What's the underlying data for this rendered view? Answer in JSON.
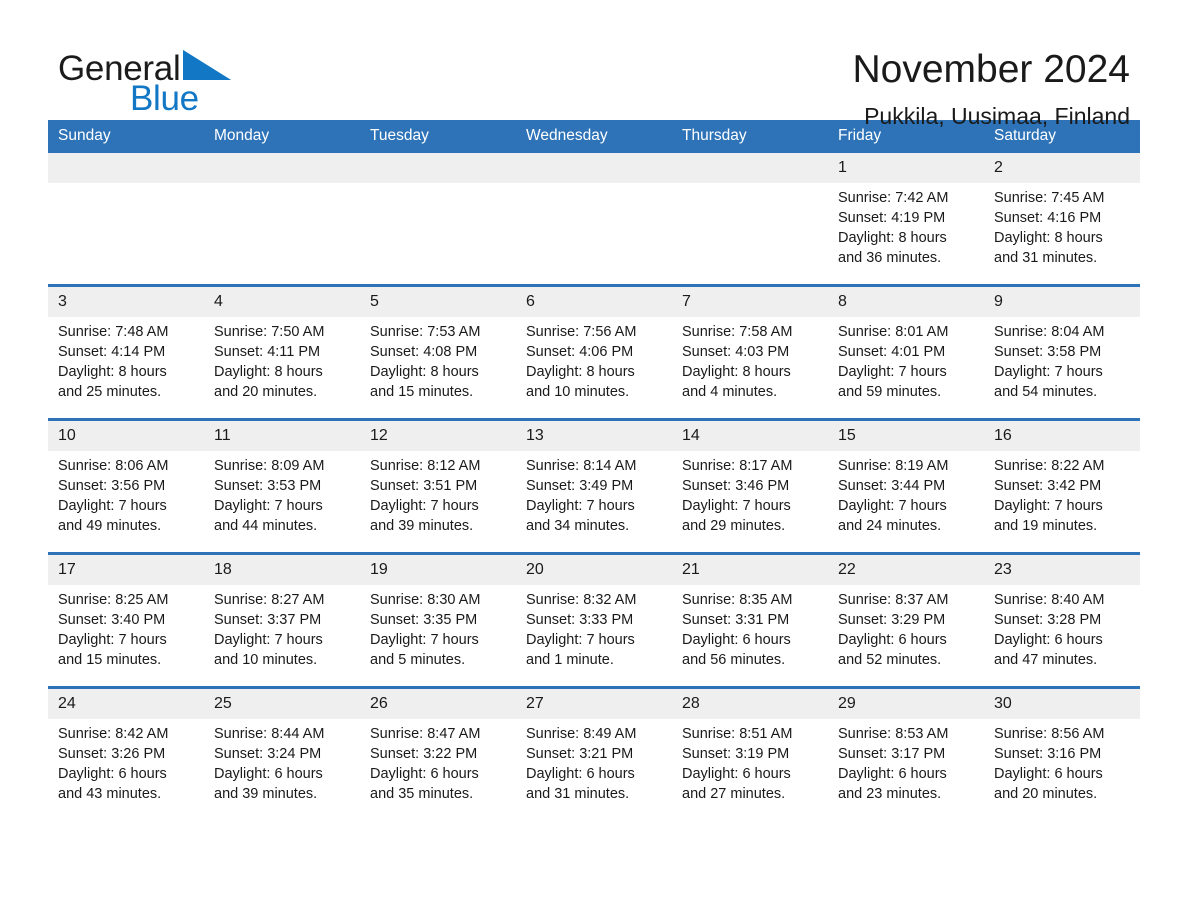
{
  "brand": {
    "word1": "General",
    "word2": "Blue",
    "logo_icon": "blue-triangle-icon",
    "accent_color": "#1277c4"
  },
  "header": {
    "title": "November 2024",
    "subtitle": "Pukkila, Uusimaa, Finland"
  },
  "calendar": {
    "header_bg": "#2e73b8",
    "daynum_bg": "#efefef",
    "weekday_headers": [
      "Sunday",
      "Monday",
      "Tuesday",
      "Wednesday",
      "Thursday",
      "Friday",
      "Saturday"
    ],
    "weeks": [
      [
        {
          "day": "",
          "sunrise": "",
          "sunset": "",
          "daylight1": "",
          "daylight2": ""
        },
        {
          "day": "",
          "sunrise": "",
          "sunset": "",
          "daylight1": "",
          "daylight2": ""
        },
        {
          "day": "",
          "sunrise": "",
          "sunset": "",
          "daylight1": "",
          "daylight2": ""
        },
        {
          "day": "",
          "sunrise": "",
          "sunset": "",
          "daylight1": "",
          "daylight2": ""
        },
        {
          "day": "",
          "sunrise": "",
          "sunset": "",
          "daylight1": "",
          "daylight2": ""
        },
        {
          "day": "1",
          "sunrise": "Sunrise: 7:42 AM",
          "sunset": "Sunset: 4:19 PM",
          "daylight1": "Daylight: 8 hours",
          "daylight2": "and 36 minutes."
        },
        {
          "day": "2",
          "sunrise": "Sunrise: 7:45 AM",
          "sunset": "Sunset: 4:16 PM",
          "daylight1": "Daylight: 8 hours",
          "daylight2": "and 31 minutes."
        }
      ],
      [
        {
          "day": "3",
          "sunrise": "Sunrise: 7:48 AM",
          "sunset": "Sunset: 4:14 PM",
          "daylight1": "Daylight: 8 hours",
          "daylight2": "and 25 minutes."
        },
        {
          "day": "4",
          "sunrise": "Sunrise: 7:50 AM",
          "sunset": "Sunset: 4:11 PM",
          "daylight1": "Daylight: 8 hours",
          "daylight2": "and 20 minutes."
        },
        {
          "day": "5",
          "sunrise": "Sunrise: 7:53 AM",
          "sunset": "Sunset: 4:08 PM",
          "daylight1": "Daylight: 8 hours",
          "daylight2": "and 15 minutes."
        },
        {
          "day": "6",
          "sunrise": "Sunrise: 7:56 AM",
          "sunset": "Sunset: 4:06 PM",
          "daylight1": "Daylight: 8 hours",
          "daylight2": "and 10 minutes."
        },
        {
          "day": "7",
          "sunrise": "Sunrise: 7:58 AM",
          "sunset": "Sunset: 4:03 PM",
          "daylight1": "Daylight: 8 hours",
          "daylight2": "and 4 minutes."
        },
        {
          "day": "8",
          "sunrise": "Sunrise: 8:01 AM",
          "sunset": "Sunset: 4:01 PM",
          "daylight1": "Daylight: 7 hours",
          "daylight2": "and 59 minutes."
        },
        {
          "day": "9",
          "sunrise": "Sunrise: 8:04 AM",
          "sunset": "Sunset: 3:58 PM",
          "daylight1": "Daylight: 7 hours",
          "daylight2": "and 54 minutes."
        }
      ],
      [
        {
          "day": "10",
          "sunrise": "Sunrise: 8:06 AM",
          "sunset": "Sunset: 3:56 PM",
          "daylight1": "Daylight: 7 hours",
          "daylight2": "and 49 minutes."
        },
        {
          "day": "11",
          "sunrise": "Sunrise: 8:09 AM",
          "sunset": "Sunset: 3:53 PM",
          "daylight1": "Daylight: 7 hours",
          "daylight2": "and 44 minutes."
        },
        {
          "day": "12",
          "sunrise": "Sunrise: 8:12 AM",
          "sunset": "Sunset: 3:51 PM",
          "daylight1": "Daylight: 7 hours",
          "daylight2": "and 39 minutes."
        },
        {
          "day": "13",
          "sunrise": "Sunrise: 8:14 AM",
          "sunset": "Sunset: 3:49 PM",
          "daylight1": "Daylight: 7 hours",
          "daylight2": "and 34 minutes."
        },
        {
          "day": "14",
          "sunrise": "Sunrise: 8:17 AM",
          "sunset": "Sunset: 3:46 PM",
          "daylight1": "Daylight: 7 hours",
          "daylight2": "and 29 minutes."
        },
        {
          "day": "15",
          "sunrise": "Sunrise: 8:19 AM",
          "sunset": "Sunset: 3:44 PM",
          "daylight1": "Daylight: 7 hours",
          "daylight2": "and 24 minutes."
        },
        {
          "day": "16",
          "sunrise": "Sunrise: 8:22 AM",
          "sunset": "Sunset: 3:42 PM",
          "daylight1": "Daylight: 7 hours",
          "daylight2": "and 19 minutes."
        }
      ],
      [
        {
          "day": "17",
          "sunrise": "Sunrise: 8:25 AM",
          "sunset": "Sunset: 3:40 PM",
          "daylight1": "Daylight: 7 hours",
          "daylight2": "and 15 minutes."
        },
        {
          "day": "18",
          "sunrise": "Sunrise: 8:27 AM",
          "sunset": "Sunset: 3:37 PM",
          "daylight1": "Daylight: 7 hours",
          "daylight2": "and 10 minutes."
        },
        {
          "day": "19",
          "sunrise": "Sunrise: 8:30 AM",
          "sunset": "Sunset: 3:35 PM",
          "daylight1": "Daylight: 7 hours",
          "daylight2": "and 5 minutes."
        },
        {
          "day": "20",
          "sunrise": "Sunrise: 8:32 AM",
          "sunset": "Sunset: 3:33 PM",
          "daylight1": "Daylight: 7 hours",
          "daylight2": "and 1 minute."
        },
        {
          "day": "21",
          "sunrise": "Sunrise: 8:35 AM",
          "sunset": "Sunset: 3:31 PM",
          "daylight1": "Daylight: 6 hours",
          "daylight2": "and 56 minutes."
        },
        {
          "day": "22",
          "sunrise": "Sunrise: 8:37 AM",
          "sunset": "Sunset: 3:29 PM",
          "daylight1": "Daylight: 6 hours",
          "daylight2": "and 52 minutes."
        },
        {
          "day": "23",
          "sunrise": "Sunrise: 8:40 AM",
          "sunset": "Sunset: 3:28 PM",
          "daylight1": "Daylight: 6 hours",
          "daylight2": "and 47 minutes."
        }
      ],
      [
        {
          "day": "24",
          "sunrise": "Sunrise: 8:42 AM",
          "sunset": "Sunset: 3:26 PM",
          "daylight1": "Daylight: 6 hours",
          "daylight2": "and 43 minutes."
        },
        {
          "day": "25",
          "sunrise": "Sunrise: 8:44 AM",
          "sunset": "Sunset: 3:24 PM",
          "daylight1": "Daylight: 6 hours",
          "daylight2": "and 39 minutes."
        },
        {
          "day": "26",
          "sunrise": "Sunrise: 8:47 AM",
          "sunset": "Sunset: 3:22 PM",
          "daylight1": "Daylight: 6 hours",
          "daylight2": "and 35 minutes."
        },
        {
          "day": "27",
          "sunrise": "Sunrise: 8:49 AM",
          "sunset": "Sunset: 3:21 PM",
          "daylight1": "Daylight: 6 hours",
          "daylight2": "and 31 minutes."
        },
        {
          "day": "28",
          "sunrise": "Sunrise: 8:51 AM",
          "sunset": "Sunset: 3:19 PM",
          "daylight1": "Daylight: 6 hours",
          "daylight2": "and 27 minutes."
        },
        {
          "day": "29",
          "sunrise": "Sunrise: 8:53 AM",
          "sunset": "Sunset: 3:17 PM",
          "daylight1": "Daylight: 6 hours",
          "daylight2": "and 23 minutes."
        },
        {
          "day": "30",
          "sunrise": "Sunrise: 8:56 AM",
          "sunset": "Sunset: 3:16 PM",
          "daylight1": "Daylight: 6 hours",
          "daylight2": "and 20 minutes."
        }
      ]
    ]
  }
}
